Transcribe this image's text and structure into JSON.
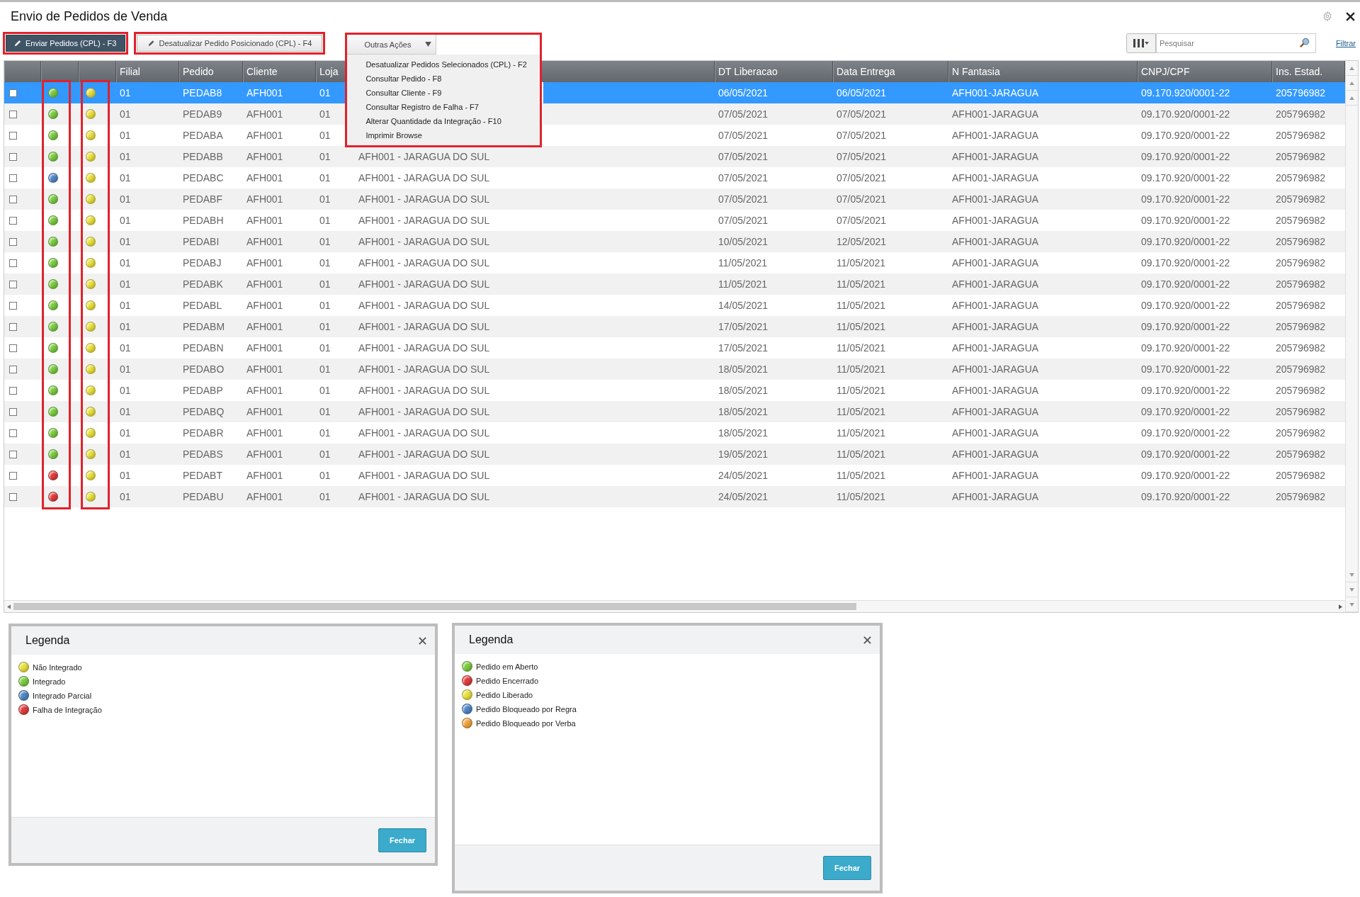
{
  "window": {
    "title": "Envio de Pedidos de Venda"
  },
  "toolbar": {
    "buttons": [
      {
        "label": "Enviar Pedidos (CPL) - F3",
        "kind": "primary"
      },
      {
        "label": "Desatualizar Pedido Posicionado (CPL) - F4",
        "kind": "secondary"
      }
    ],
    "more_actions": {
      "label": "Outras Ações",
      "expanded": true,
      "items": [
        "Desatualizar Pedidos Selecionados (CPL) - F2",
        "Consultar Pedido - F8",
        "Consultar Cliente - F9",
        "Consultar Registro de Falha - F7",
        "Alterar Quantidade da Integração - F10",
        "Imprimir Browse"
      ]
    },
    "search": {
      "placeholder": "Pesquisar"
    },
    "filter_link": "Filtrar"
  },
  "table": {
    "columns": [
      "Filial",
      "Pedido",
      "Cliente",
      "Loja",
      "DT Liberacao",
      "Data Entrega",
      "N Fantasia",
      "CNPJ/CPF",
      "Ins. Estad."
    ],
    "rows": [
      {
        "selected": true,
        "checked": false,
        "status_1": {
          "color": "#7acb3f"
        },
        "status_2": {
          "color": "#e8df3a"
        },
        "filial": "01",
        "pedido": "PEDAB8",
        "cliente": "AFH001",
        "loja": "01",
        "dt_liberacao": "06/05/2021",
        "data_entrega": "06/05/2021",
        "n_fantasia": "AFH001-JARAGUA",
        "cnpj": "09.170.920/0001-22",
        "ins_estad": "205796982"
      },
      {
        "selected": false,
        "checked": false,
        "status_1": {
          "color": "#7acb3f"
        },
        "status_2": {
          "color": "#e8df3a"
        },
        "filial": "01",
        "pedido": "PEDAB9",
        "cliente": "AFH001",
        "loja": "01",
        "dt_liberacao": "07/05/2021",
        "data_entrega": "07/05/2021",
        "n_fantasia": "AFH001-JARAGUA",
        "cnpj": "09.170.920/0001-22",
        "ins_estad": "205796982"
      },
      {
        "selected": false,
        "checked": false,
        "status_1": {
          "color": "#7acb3f"
        },
        "status_2": {
          "color": "#e8df3a"
        },
        "filial": "01",
        "pedido": "PEDABA",
        "cliente": "AFH001",
        "loja": "01",
        "dt_liberacao": "07/05/2021",
        "data_entrega": "07/05/2021",
        "n_fantasia": "AFH001-JARAGUA",
        "cnpj": "09.170.920/0001-22",
        "ins_estad": "205796982"
      },
      {
        "selected": false,
        "checked": false,
        "status_1": {
          "color": "#7acb3f"
        },
        "status_2": {
          "color": "#e8df3a"
        },
        "filial": "01",
        "pedido": "PEDABB",
        "cliente": "AFH001",
        "loja": "01",
        "column_6": "AFH001 - JARAGUA DO SUL",
        "dt_liberacao": "07/05/2021",
        "data_entrega": "07/05/2021",
        "n_fantasia": "AFH001-JARAGUA",
        "cnpj": "09.170.920/0001-22",
        "ins_estad": "205796982"
      },
      {
        "selected": false,
        "checked": false,
        "status_1": {
          "color": "#4f86c6"
        },
        "status_2": {
          "color": "#e8df3a"
        },
        "filial": "01",
        "pedido": "PEDABC",
        "cliente": "AFH001",
        "loja": "01",
        "column_6": "AFH001 - JARAGUA DO SUL",
        "dt_liberacao": "07/05/2021",
        "data_entrega": "07/05/2021",
        "n_fantasia": "AFH001-JARAGUA",
        "cnpj": "09.170.920/0001-22",
        "ins_estad": "205796982"
      },
      {
        "selected": false,
        "checked": false,
        "status_1": {
          "color": "#7acb3f"
        },
        "status_2": {
          "color": "#e8df3a"
        },
        "filial": "01",
        "pedido": "PEDABF",
        "cliente": "AFH001",
        "loja": "01",
        "column_6": "AFH001 - JARAGUA DO SUL",
        "dt_liberacao": "07/05/2021",
        "data_entrega": "07/05/2021",
        "n_fantasia": "AFH001-JARAGUA",
        "cnpj": "09.170.920/0001-22",
        "ins_estad": "205796982"
      },
      {
        "selected": false,
        "checked": false,
        "status_1": {
          "color": "#7acb3f"
        },
        "status_2": {
          "color": "#e8df3a"
        },
        "filial": "01",
        "pedido": "PEDABH",
        "cliente": "AFH001",
        "loja": "01",
        "column_6": "AFH001 - JARAGUA DO SUL",
        "dt_liberacao": "07/05/2021",
        "data_entrega": "07/05/2021",
        "n_fantasia": "AFH001-JARAGUA",
        "cnpj": "09.170.920/0001-22",
        "ins_estad": "205796982"
      },
      {
        "selected": false,
        "checked": false,
        "status_1": {
          "color": "#7acb3f"
        },
        "status_2": {
          "color": "#e8df3a"
        },
        "filial": "01",
        "pedido": "PEDABI",
        "cliente": "AFH001",
        "loja": "01",
        "column_6": "AFH001 - JARAGUA DO SUL",
        "dt_liberacao": "10/05/2021",
        "data_entrega": "12/05/2021",
        "n_fantasia": "AFH001-JARAGUA",
        "cnpj": "09.170.920/0001-22",
        "ins_estad": "205796982"
      },
      {
        "selected": false,
        "checked": false,
        "status_1": {
          "color": "#7acb3f"
        },
        "status_2": {
          "color": "#e8df3a"
        },
        "filial": "01",
        "pedido": "PEDABJ",
        "cliente": "AFH001",
        "loja": "01",
        "column_6": "AFH001 - JARAGUA DO SUL",
        "dt_liberacao": "11/05/2021",
        "data_entrega": "11/05/2021",
        "n_fantasia": "AFH001-JARAGUA",
        "cnpj": "09.170.920/0001-22",
        "ins_estad": "205796982"
      },
      {
        "selected": false,
        "checked": false,
        "status_1": {
          "color": "#7acb3f"
        },
        "status_2": {
          "color": "#e8df3a"
        },
        "filial": "01",
        "pedido": "PEDABK",
        "cliente": "AFH001",
        "loja": "01",
        "column_6": "AFH001 - JARAGUA DO SUL",
        "dt_liberacao": "11/05/2021",
        "data_entrega": "11/05/2021",
        "n_fantasia": "AFH001-JARAGUA",
        "cnpj": "09.170.920/0001-22",
        "ins_estad": "205796982"
      },
      {
        "selected": false,
        "checked": false,
        "status_1": {
          "color": "#7acb3f"
        },
        "status_2": {
          "color": "#e8df3a"
        },
        "filial": "01",
        "pedido": "PEDABL",
        "cliente": "AFH001",
        "loja": "01",
        "column_6": "AFH001 - JARAGUA DO SUL",
        "dt_liberacao": "14/05/2021",
        "data_entrega": "11/05/2021",
        "n_fantasia": "AFH001-JARAGUA",
        "cnpj": "09.170.920/0001-22",
        "ins_estad": "205796982"
      },
      {
        "selected": false,
        "checked": false,
        "status_1": {
          "color": "#7acb3f"
        },
        "status_2": {
          "color": "#e8df3a"
        },
        "filial": "01",
        "pedido": "PEDABM",
        "cliente": "AFH001",
        "loja": "01",
        "column_6": "AFH001 - JARAGUA DO SUL",
        "dt_liberacao": "17/05/2021",
        "data_entrega": "11/05/2021",
        "n_fantasia": "AFH001-JARAGUA",
        "cnpj": "09.170.920/0001-22",
        "ins_estad": "205796982"
      },
      {
        "selected": false,
        "checked": false,
        "status_1": {
          "color": "#7acb3f"
        },
        "status_2": {
          "color": "#e8df3a"
        },
        "filial": "01",
        "pedido": "PEDABN",
        "cliente": "AFH001",
        "loja": "01",
        "column_6": "AFH001 - JARAGUA DO SUL",
        "dt_liberacao": "17/05/2021",
        "data_entrega": "11/05/2021",
        "n_fantasia": "AFH001-JARAGUA",
        "cnpj": "09.170.920/0001-22",
        "ins_estad": "205796982"
      },
      {
        "selected": false,
        "checked": false,
        "status_1": {
          "color": "#7acb3f"
        },
        "status_2": {
          "color": "#e8df3a"
        },
        "filial": "01",
        "pedido": "PEDABO",
        "cliente": "AFH001",
        "loja": "01",
        "column_6": "AFH001 - JARAGUA DO SUL",
        "dt_liberacao": "18/05/2021",
        "data_entrega": "11/05/2021",
        "n_fantasia": "AFH001-JARAGUA",
        "cnpj": "09.170.920/0001-22",
        "ins_estad": "205796982"
      },
      {
        "selected": false,
        "checked": false,
        "status_1": {
          "color": "#7acb3f"
        },
        "status_2": {
          "color": "#e8df3a"
        },
        "filial": "01",
        "pedido": "PEDABP",
        "cliente": "AFH001",
        "loja": "01",
        "column_6": "AFH001 - JARAGUA DO SUL",
        "dt_liberacao": "18/05/2021",
        "data_entrega": "11/05/2021",
        "n_fantasia": "AFH001-JARAGUA",
        "cnpj": "09.170.920/0001-22",
        "ins_estad": "205796982"
      },
      {
        "selected": false,
        "checked": false,
        "status_1": {
          "color": "#7acb3f"
        },
        "status_2": {
          "color": "#e8df3a"
        },
        "filial": "01",
        "pedido": "PEDABQ",
        "cliente": "AFH001",
        "loja": "01",
        "column_6": "AFH001 - JARAGUA DO SUL",
        "dt_liberacao": "18/05/2021",
        "data_entrega": "11/05/2021",
        "n_fantasia": "AFH001-JARAGUA",
        "cnpj": "09.170.920/0001-22",
        "ins_estad": "205796982"
      },
      {
        "selected": false,
        "checked": false,
        "status_1": {
          "color": "#7acb3f"
        },
        "status_2": {
          "color": "#e8df3a"
        },
        "filial": "01",
        "pedido": "PEDABR",
        "cliente": "AFH001",
        "loja": "01",
        "column_6": "AFH001 - JARAGUA DO SUL",
        "dt_liberacao": "18/05/2021",
        "data_entrega": "11/05/2021",
        "n_fantasia": "AFH001-JARAGUA",
        "cnpj": "09.170.920/0001-22",
        "ins_estad": "205796982"
      },
      {
        "selected": false,
        "checked": false,
        "status_1": {
          "color": "#7acb3f"
        },
        "status_2": {
          "color": "#e8df3a"
        },
        "filial": "01",
        "pedido": "PEDABS",
        "cliente": "AFH001",
        "loja": "01",
        "column_6": "AFH001 - JARAGUA DO SUL",
        "dt_liberacao": "19/05/2021",
        "data_entrega": "11/05/2021",
        "n_fantasia": "AFH001-JARAGUA",
        "cnpj": "09.170.920/0001-22",
        "ins_estad": "205796982"
      },
      {
        "selected": false,
        "checked": false,
        "status_1": {
          "color": "#e03c3c"
        },
        "status_2": {
          "color": "#e8df3a"
        },
        "filial": "01",
        "pedido": "PEDABT",
        "cliente": "AFH001",
        "loja": "01",
        "column_6": "AFH001 - JARAGUA DO SUL",
        "dt_liberacao": "24/05/2021",
        "data_entrega": "11/05/2021",
        "n_fantasia": "AFH001-JARAGUA",
        "cnpj": "09.170.920/0001-22",
        "ins_estad": "205796982"
      },
      {
        "selected": false,
        "checked": false,
        "status_1": {
          "color": "#e03c3c"
        },
        "status_2": {
          "color": "#e8df3a"
        },
        "filial": "01",
        "pedido": "PEDABU",
        "cliente": "AFH001",
        "loja": "01",
        "column_6": "AFH001 - JARAGUA DO SUL",
        "dt_liberacao": "24/05/2021",
        "data_entrega": "11/05/2021",
        "n_fantasia": "AFH001-JARAGUA",
        "cnpj": "09.170.920/0001-22",
        "ins_estad": "205796982"
      }
    ]
  },
  "legend_dialogs": [
    {
      "title": "Legenda",
      "items": [
        {
          "label": "Não Integrado",
          "color": "#e8df3a"
        },
        {
          "label": "Integrado",
          "color": "#7acb3f"
        },
        {
          "label": "Integrado Parcial",
          "color": "#4f86c6"
        },
        {
          "label": "Falha de Integração",
          "color": "#e03c3c"
        }
      ],
      "button": "Fechar"
    },
    {
      "title": "Legenda",
      "items": [
        {
          "label": "Pedido em Aberto",
          "color": "#7acb3f"
        },
        {
          "label": "Pedido Encerrado",
          "color": "#e03c3c"
        },
        {
          "label": "Pedido Liberado",
          "color": "#e8df3a"
        },
        {
          "label": "Pedido Bloqueado por Regra",
          "color": "#4f86c6"
        },
        {
          "label": "Pedido Bloqueado por Verba",
          "color": "#f0a23a"
        }
      ],
      "button": "Fechar"
    }
  ]
}
